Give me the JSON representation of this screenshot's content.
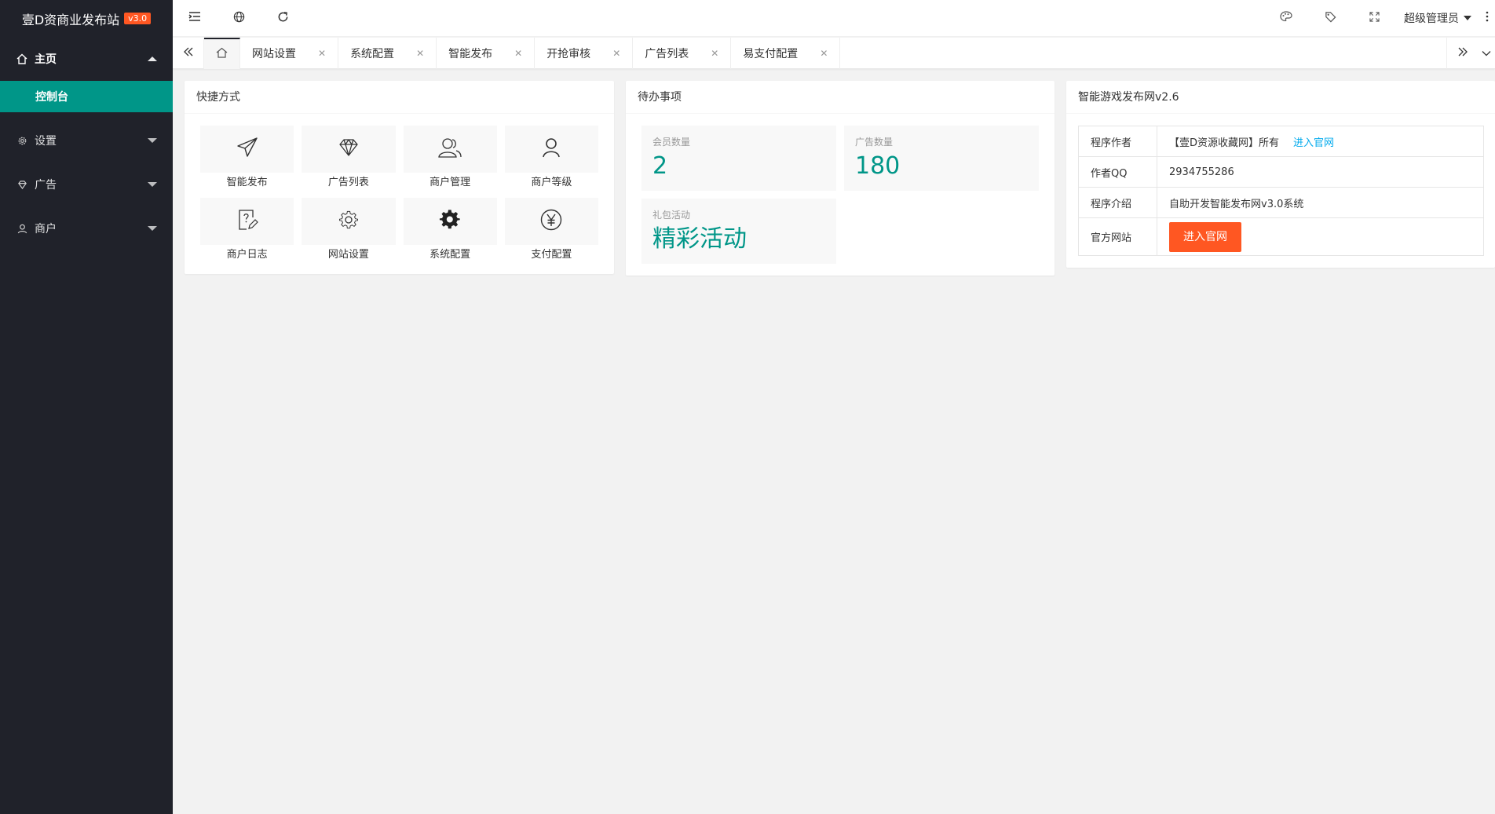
{
  "logo": {
    "title": "壹D资商业发布站",
    "version": "v3.0"
  },
  "sidebar": {
    "items": [
      {
        "label": "主页",
        "icon": "home-icon",
        "expanded": true,
        "sub": [
          {
            "label": "控制台",
            "active": true
          }
        ]
      },
      {
        "label": "设置",
        "icon": "gear-icon",
        "expanded": false
      },
      {
        "label": "广告",
        "icon": "diamond-icon",
        "expanded": false
      },
      {
        "label": "商户",
        "icon": "user-icon",
        "expanded": false
      }
    ]
  },
  "header": {
    "user": "超级管理员"
  },
  "tabs": [
    {
      "label": "网站设置"
    },
    {
      "label": "系统配置"
    },
    {
      "label": "智能发布"
    },
    {
      "label": "开抢审核"
    },
    {
      "label": "广告列表"
    },
    {
      "label": "易支付配置"
    }
  ],
  "quick": {
    "title": "快捷方式",
    "items": [
      {
        "label": "智能发布",
        "icon": "paper-plane-icon"
      },
      {
        "label": "广告列表",
        "icon": "diamond-icon"
      },
      {
        "label": "商户管理",
        "icon": "users-icon"
      },
      {
        "label": "商户等级",
        "icon": "user-icon"
      },
      {
        "label": "商户日志",
        "icon": "log-edit-icon"
      },
      {
        "label": "网站设置",
        "icon": "gear-outline-icon"
      },
      {
        "label": "系统配置",
        "icon": "gear-solid-icon"
      },
      {
        "label": "支付配置",
        "icon": "yen-icon"
      }
    ]
  },
  "todo": {
    "title": "待办事项",
    "items": [
      {
        "label": "会员数量",
        "value": "2"
      },
      {
        "label": "广告数量",
        "value": "180"
      },
      {
        "label": "礼包活动",
        "value": "精彩活动"
      }
    ]
  },
  "info": {
    "title": "智能游戏发布网v2.6",
    "author_key": "程序作者",
    "author_value": "【壹D资源收藏网】所有",
    "author_link": "进入官网",
    "qq_key": "作者QQ",
    "qq_value": "2934755286",
    "intro_key": "程序介绍",
    "intro_value": "自助开发智能发布网v3.0系统",
    "site_key": "官方网站",
    "site_button": "进入官网"
  },
  "colors": {
    "accent": "#009688",
    "sidebar": "#20222a",
    "orange": "#ff5722",
    "link": "#01aaed"
  }
}
